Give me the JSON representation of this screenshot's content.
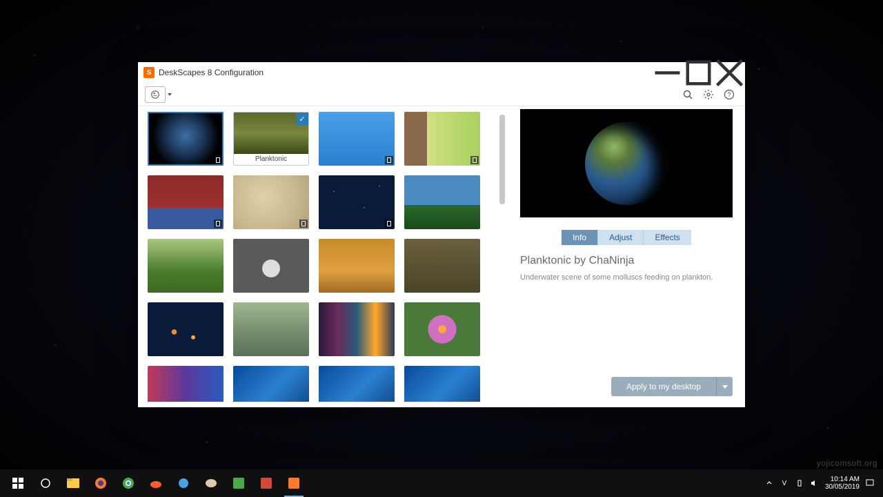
{
  "window": {
    "title": "DeskScapes 8 Configuration"
  },
  "gallery": {
    "selected_label": "Planktonic"
  },
  "tabs": {
    "info": "Info",
    "adjust": "Adjust",
    "effects": "Effects"
  },
  "details": {
    "title": "Planktonic by ChaNinja",
    "description": "Underwater scene of some molluscs feeding on plankton."
  },
  "apply": {
    "label": "Apply to my desktop"
  },
  "taskbar": {
    "time": "10:14 AM",
    "date": "30/05/2019"
  },
  "watermark": "yojicomsoft.org"
}
